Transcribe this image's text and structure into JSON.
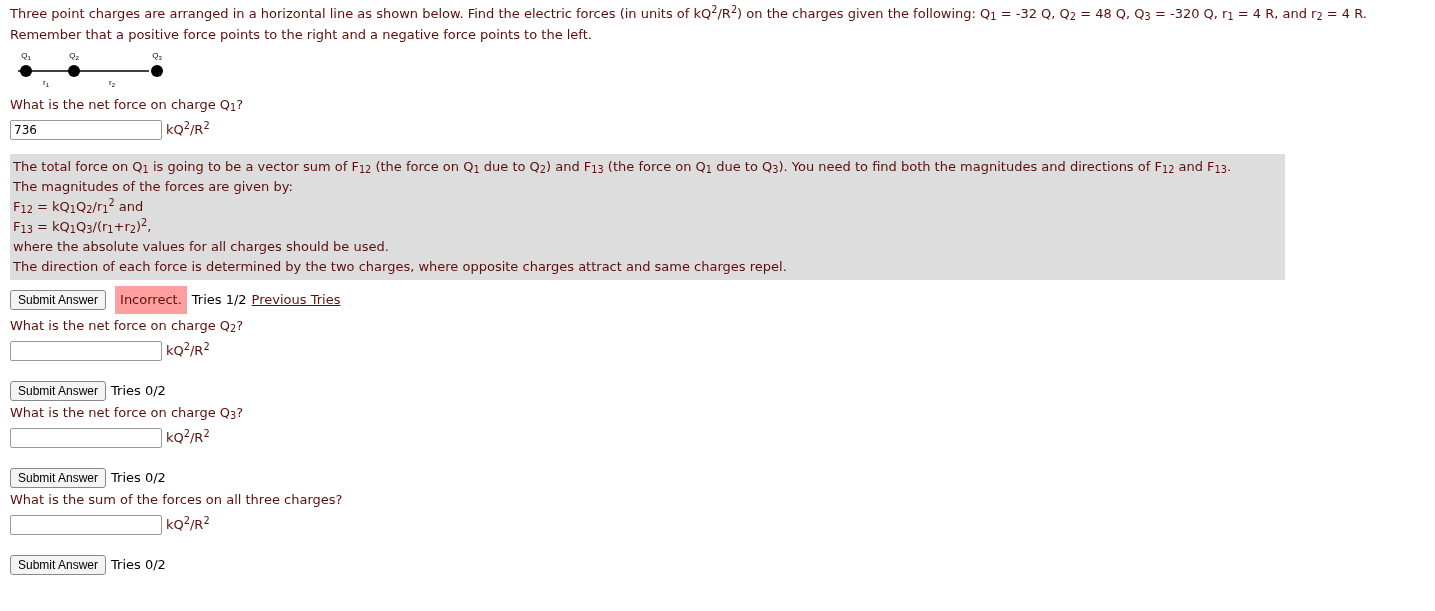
{
  "intro": [
    "Three point charges are arranged in a horizontal line as shown below. Find the electric forces (in units of kQ$^{2}$/R$^{2}$) on the charges given the following: Q$_{1}$ = -32 Q, Q$_{2}$ = 48 Q, Q$_{3}$ = -320 Q, r$_{1}$ = 4 R, and r$_{2}$ = 4 R.",
    "Remember that a positive force points to the right and a negative force points to the left."
  ],
  "diagram": {
    "charges": [
      "Q$_{1}$",
      "Q$_{2}$",
      "Q$_{3}$"
    ],
    "distances": [
      "r$_{1}$",
      "r$_{2}$"
    ]
  },
  "parts": [
    {
      "question": "What is the net force on charge Q$_{1}$?",
      "value": "736",
      "unit": "kQ$^{2}$/R$^{2}$",
      "hint": [
        "The total force on Q$_{1}$ is going to be a vector sum of F$_{12}$ (the force on Q$_{1}$ due to Q$_{2}$) and F$_{13}$ (the force on Q$_{1}$ due to Q$_{3}$). You need to find both the magnitudes and directions of F$_{12}$ and F$_{13}$.",
        "The magnitudes of the forces are given by:",
        "F$_{12}$ = kQ$_{1}$Q$_{2}$/r$_{1}$$^{2}$ and",
        "F$_{13}$ = kQ$_{1}$Q$_{3}$/(r$_{1}$+r$_{2}$)$^{2}$,",
        "where the absolute values for all charges should be used.",
        "The direction of each force is determined by the two charges, where opposite charges attract and same charges repel."
      ],
      "button": "Submit Answer",
      "status": "Incorrect.",
      "tries": "Tries 1/2",
      "link": "Previous Tries"
    },
    {
      "question": "What is the net force on charge Q$_{2}$?",
      "unit": "kQ$^{2}$/R$^{2}$",
      "button": "Submit Answer",
      "tries": "Tries 0/2"
    },
    {
      "question": "What is the net force on charge Q$_{3}$?",
      "unit": "kQ$^{2}$/R$^{2}$",
      "button": "Submit Answer",
      "tries": "Tries 0/2"
    },
    {
      "question": "What is the sum of the forces on all three charges?",
      "unit": "kQ$^{2}$/R$^{2}$",
      "button": "Submit Answer",
      "tries": "Tries 0/2"
    }
  ]
}
